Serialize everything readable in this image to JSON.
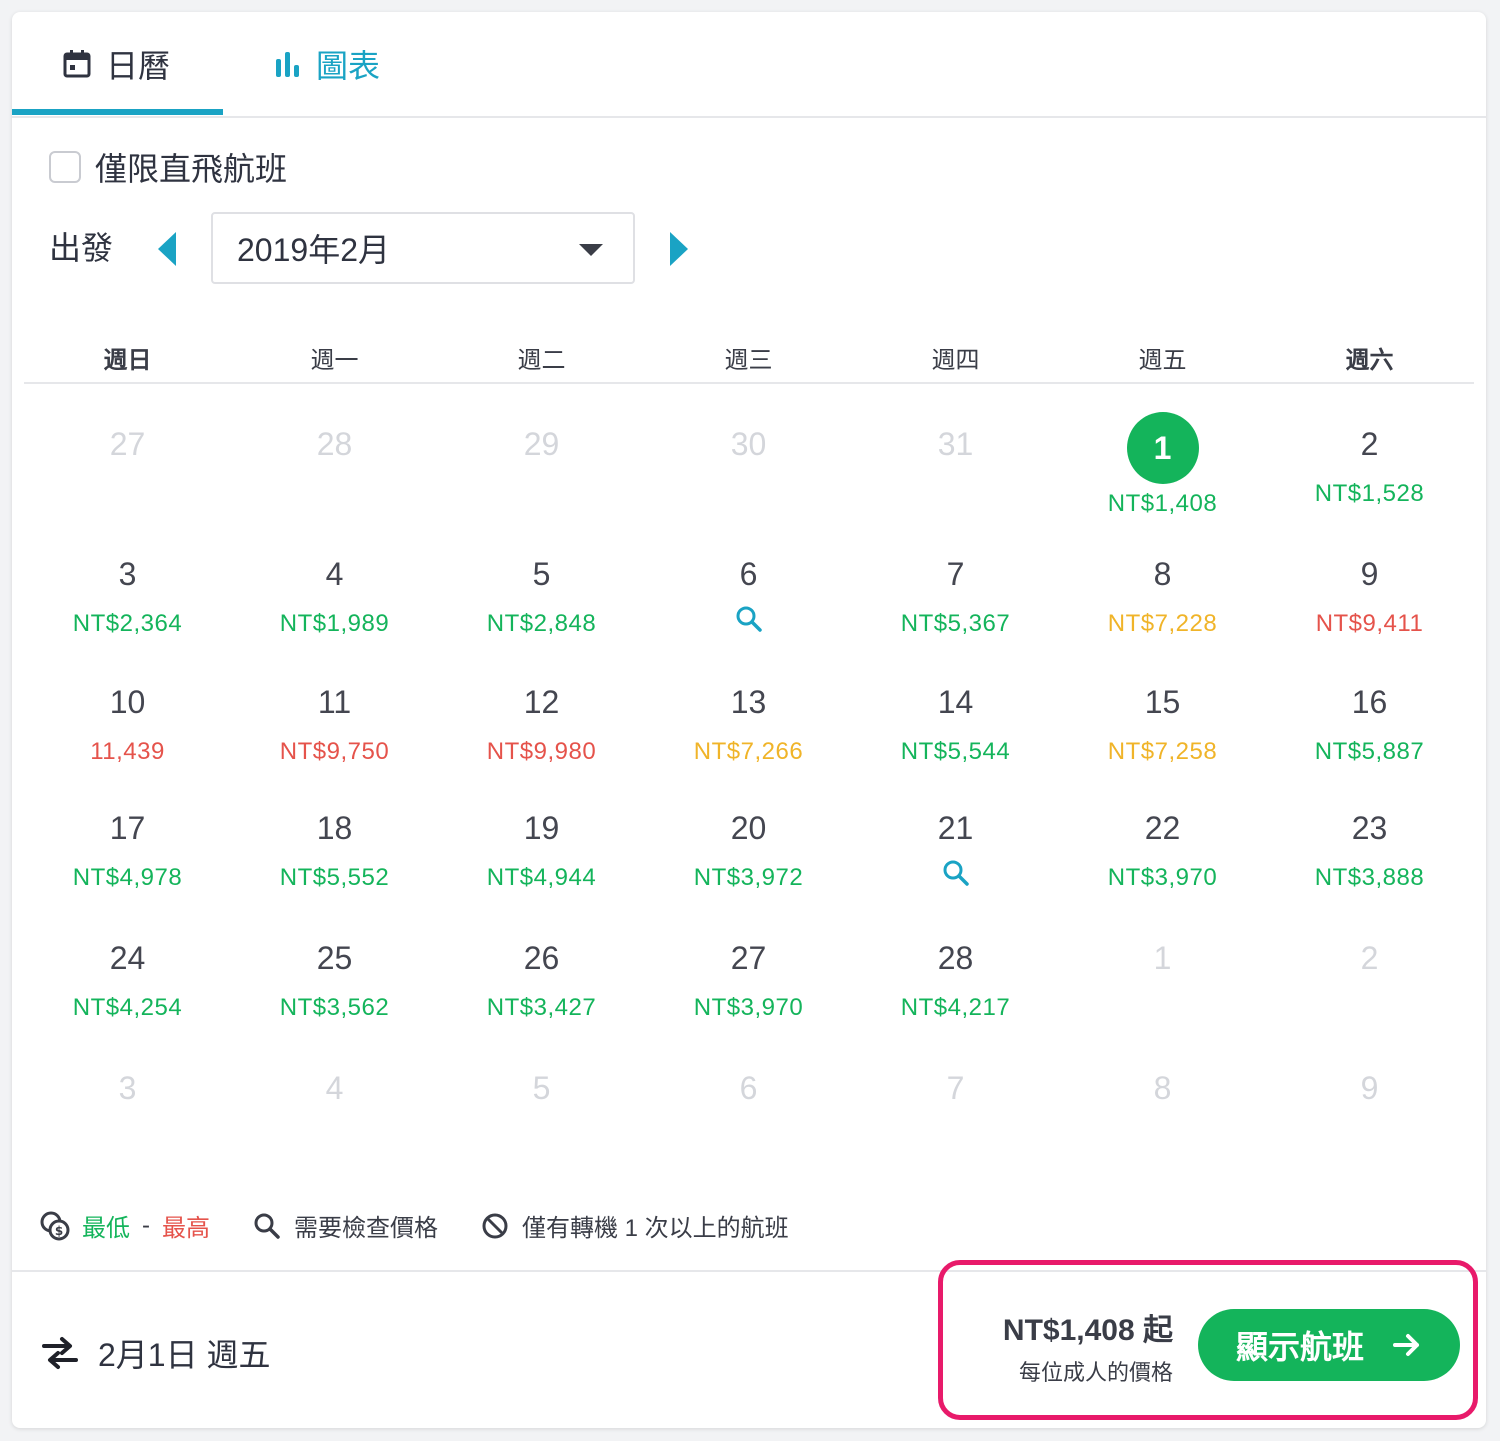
{
  "tabs": {
    "calendar": {
      "label": "日曆",
      "icon": "calendar-icon"
    },
    "chart": {
      "label": "圖表",
      "icon": "bar-chart-icon"
    }
  },
  "filters": {
    "direct_only_label": "僅限直飛航班",
    "direct_only_checked": false
  },
  "depart": {
    "label": "出發",
    "month_value": "2019年2月",
    "prev_icon": "triangle-left-icon",
    "next_icon": "triangle-right-icon"
  },
  "calendar": {
    "weekdays": [
      "週日",
      "週一",
      "週二",
      "週三",
      "週四",
      "週五",
      "週六"
    ],
    "weeks": [
      [
        {
          "day": "27",
          "other": true
        },
        {
          "day": "28",
          "other": true
        },
        {
          "day": "29",
          "other": true
        },
        {
          "day": "30",
          "other": true
        },
        {
          "day": "31",
          "other": true
        },
        {
          "day": "1",
          "price": "NT$1,408",
          "level": "low",
          "selected": true
        },
        {
          "day": "2",
          "price": "NT$1,528",
          "level": "low"
        }
      ],
      [
        {
          "day": "3",
          "price": "NT$2,364",
          "level": "low"
        },
        {
          "day": "4",
          "price": "NT$1,989",
          "level": "low"
        },
        {
          "day": "5",
          "price": "NT$2,848",
          "level": "low"
        },
        {
          "day": "6",
          "search": true
        },
        {
          "day": "7",
          "price": "NT$5,367",
          "level": "low"
        },
        {
          "day": "8",
          "price": "NT$7,228",
          "level": "mid"
        },
        {
          "day": "9",
          "price": "NT$9,411",
          "level": "high"
        }
      ],
      [
        {
          "day": "10",
          "price": "11,439",
          "level": "high"
        },
        {
          "day": "11",
          "price": "NT$9,750",
          "level": "high"
        },
        {
          "day": "12",
          "price": "NT$9,980",
          "level": "high"
        },
        {
          "day": "13",
          "price": "NT$7,266",
          "level": "mid"
        },
        {
          "day": "14",
          "price": "NT$5,544",
          "level": "low"
        },
        {
          "day": "15",
          "price": "NT$7,258",
          "level": "mid"
        },
        {
          "day": "16",
          "price": "NT$5,887",
          "level": "low"
        }
      ],
      [
        {
          "day": "17",
          "price": "NT$4,978",
          "level": "low"
        },
        {
          "day": "18",
          "price": "NT$5,552",
          "level": "low"
        },
        {
          "day": "19",
          "price": "NT$4,944",
          "level": "low"
        },
        {
          "day": "20",
          "price": "NT$3,972",
          "level": "low"
        },
        {
          "day": "21",
          "search": true
        },
        {
          "day": "22",
          "price": "NT$3,970",
          "level": "low"
        },
        {
          "day": "23",
          "price": "NT$3,888",
          "level": "low"
        }
      ],
      [
        {
          "day": "24",
          "price": "NT$4,254",
          "level": "low"
        },
        {
          "day": "25",
          "price": "NT$3,562",
          "level": "low"
        },
        {
          "day": "26",
          "price": "NT$3,427",
          "level": "low"
        },
        {
          "day": "27",
          "price": "NT$3,970",
          "level": "low"
        },
        {
          "day": "28",
          "price": "NT$4,217",
          "level": "low"
        },
        {
          "day": "1",
          "other": true
        },
        {
          "day": "2",
          "other": true
        }
      ],
      [
        {
          "day": "3",
          "other": true
        },
        {
          "day": "4",
          "other": true
        },
        {
          "day": "5",
          "other": true
        },
        {
          "day": "6",
          "other": true
        },
        {
          "day": "7",
          "other": true
        },
        {
          "day": "8",
          "other": true
        },
        {
          "day": "9",
          "other": true
        }
      ]
    ]
  },
  "legend": {
    "lowest": "最低",
    "dash": "-",
    "highest": "最高",
    "check_price": "需要檢查價格",
    "transfer_only": "僅有轉機 1 次以上的航班"
  },
  "footer": {
    "selected_date": "2月1日 週五",
    "price_from": "NT$1,408 起",
    "per_adult": "每位成人的價格",
    "show_button": "顯示航班"
  },
  "colors": {
    "accent": "#1aa3c4",
    "low": "#14b45b",
    "mid": "#f0b429",
    "high": "#e5534b",
    "highlight": "#e81a6a"
  }
}
